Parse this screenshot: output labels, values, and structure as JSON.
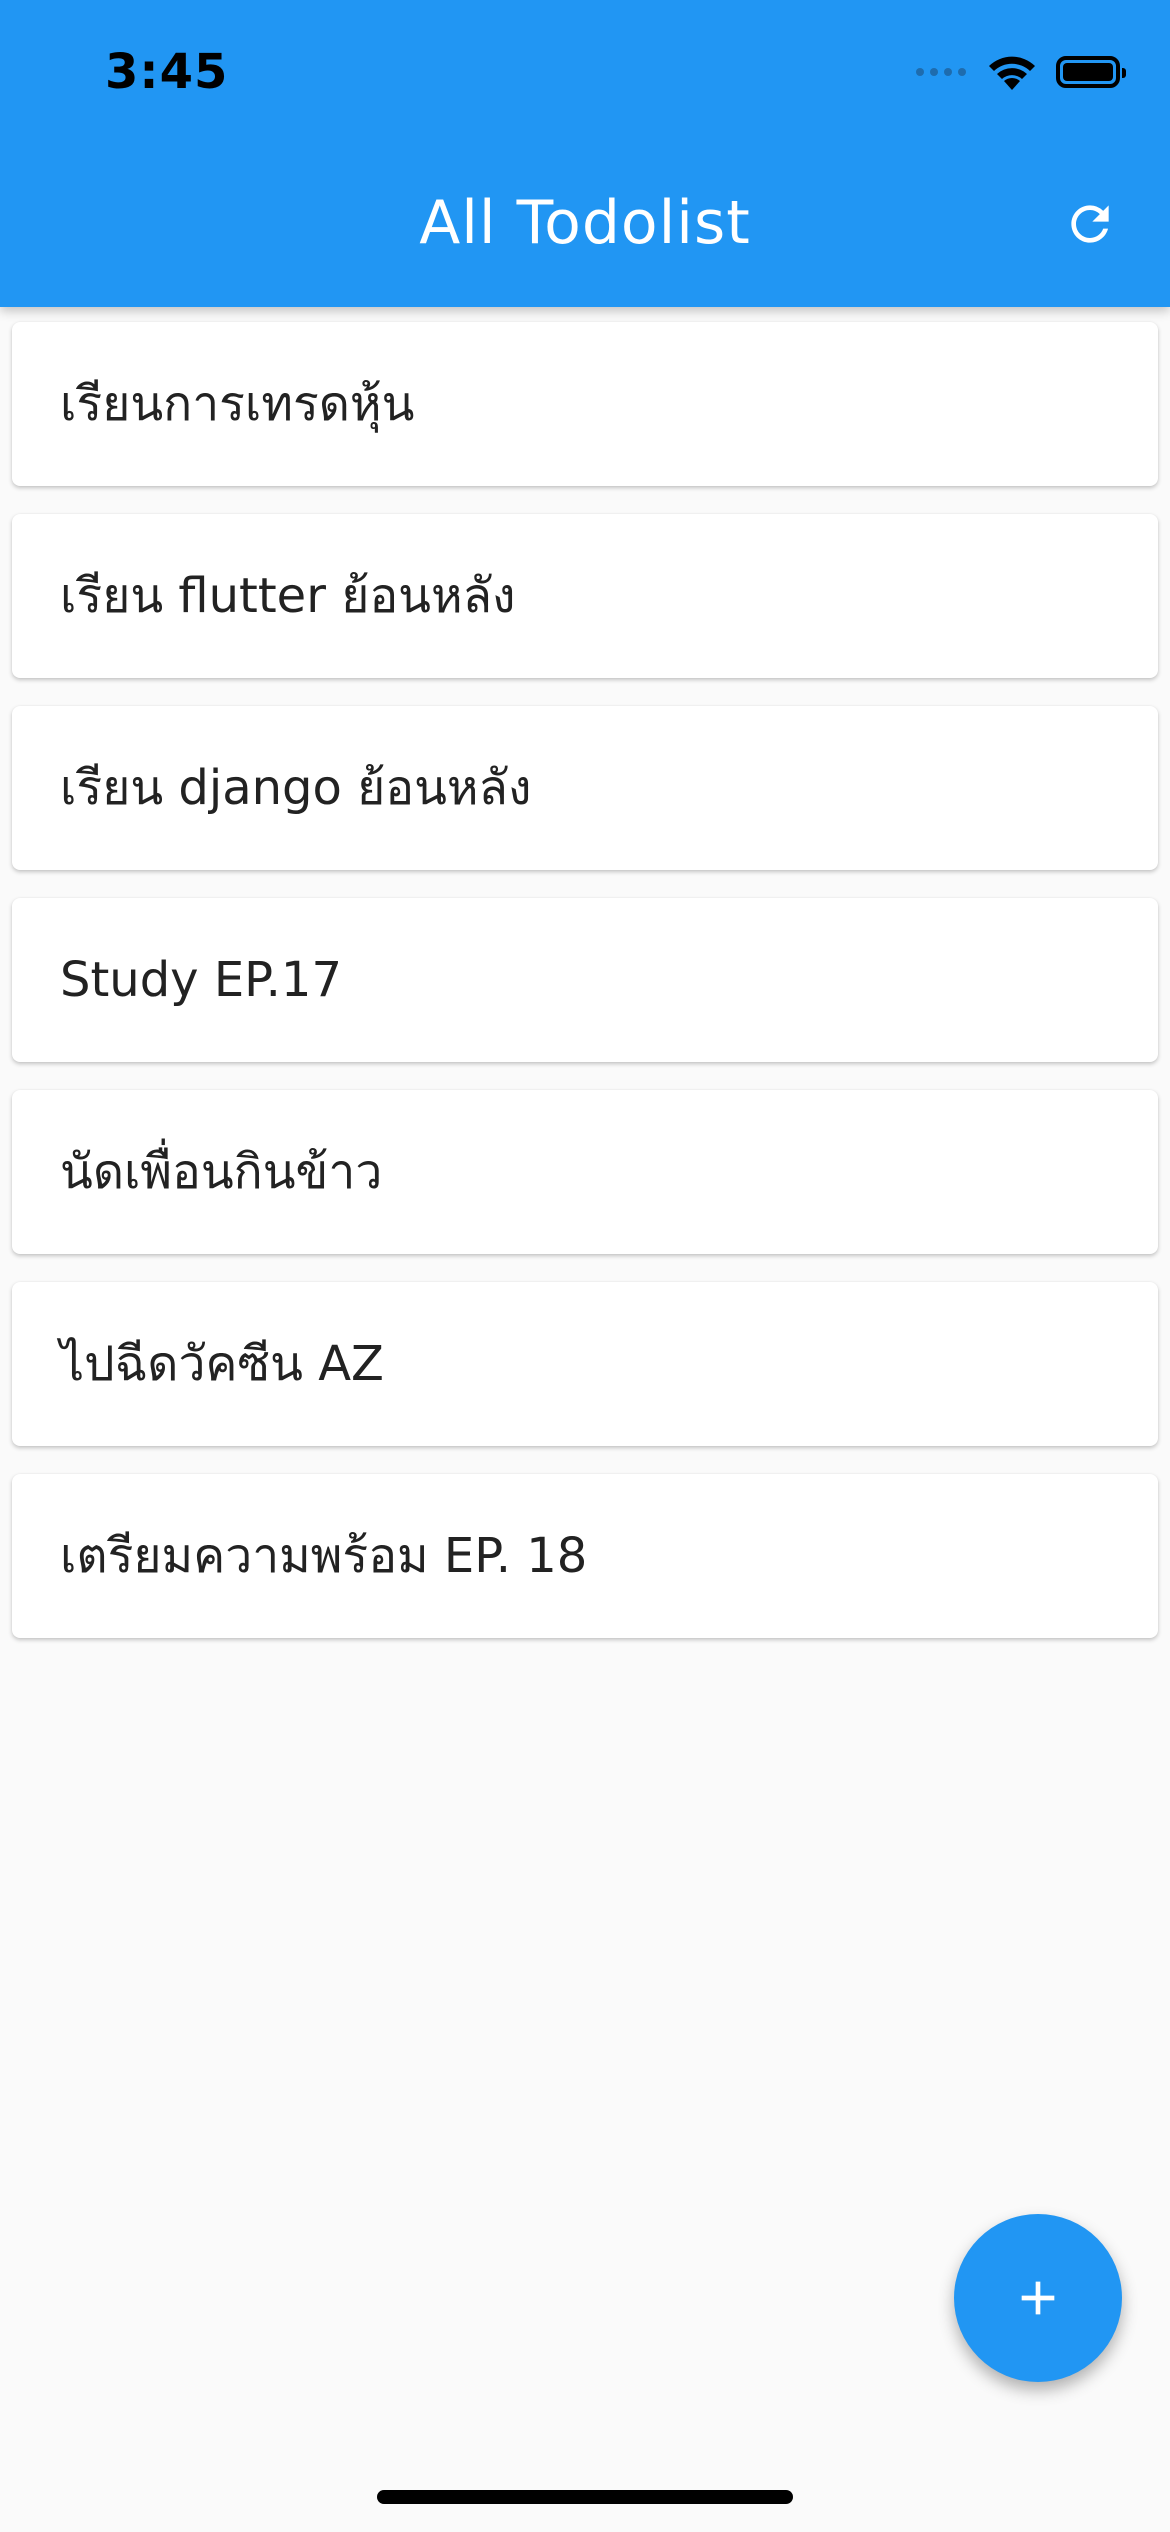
{
  "status_bar": {
    "time": "3:45"
  },
  "app_bar": {
    "title": "All Todolist",
    "background_color": "#2196f3",
    "refresh_icon": "refresh-icon"
  },
  "todos": [
    {
      "title": "เรียนการเทรดหุ้น"
    },
    {
      "title": "เรียน flutter ย้อนหลัง"
    },
    {
      "title": "เรียน django ย้อนหลัง"
    },
    {
      "title": "Study EP.17"
    },
    {
      "title": "นัดเพื่อนกินข้าว"
    },
    {
      "title": "ไปฉีดวัคซีน AZ"
    },
    {
      "title": "เตรียมความพร้อม EP. 18"
    }
  ],
  "fab": {
    "icon": "plus-icon",
    "color": "#2196f3"
  }
}
